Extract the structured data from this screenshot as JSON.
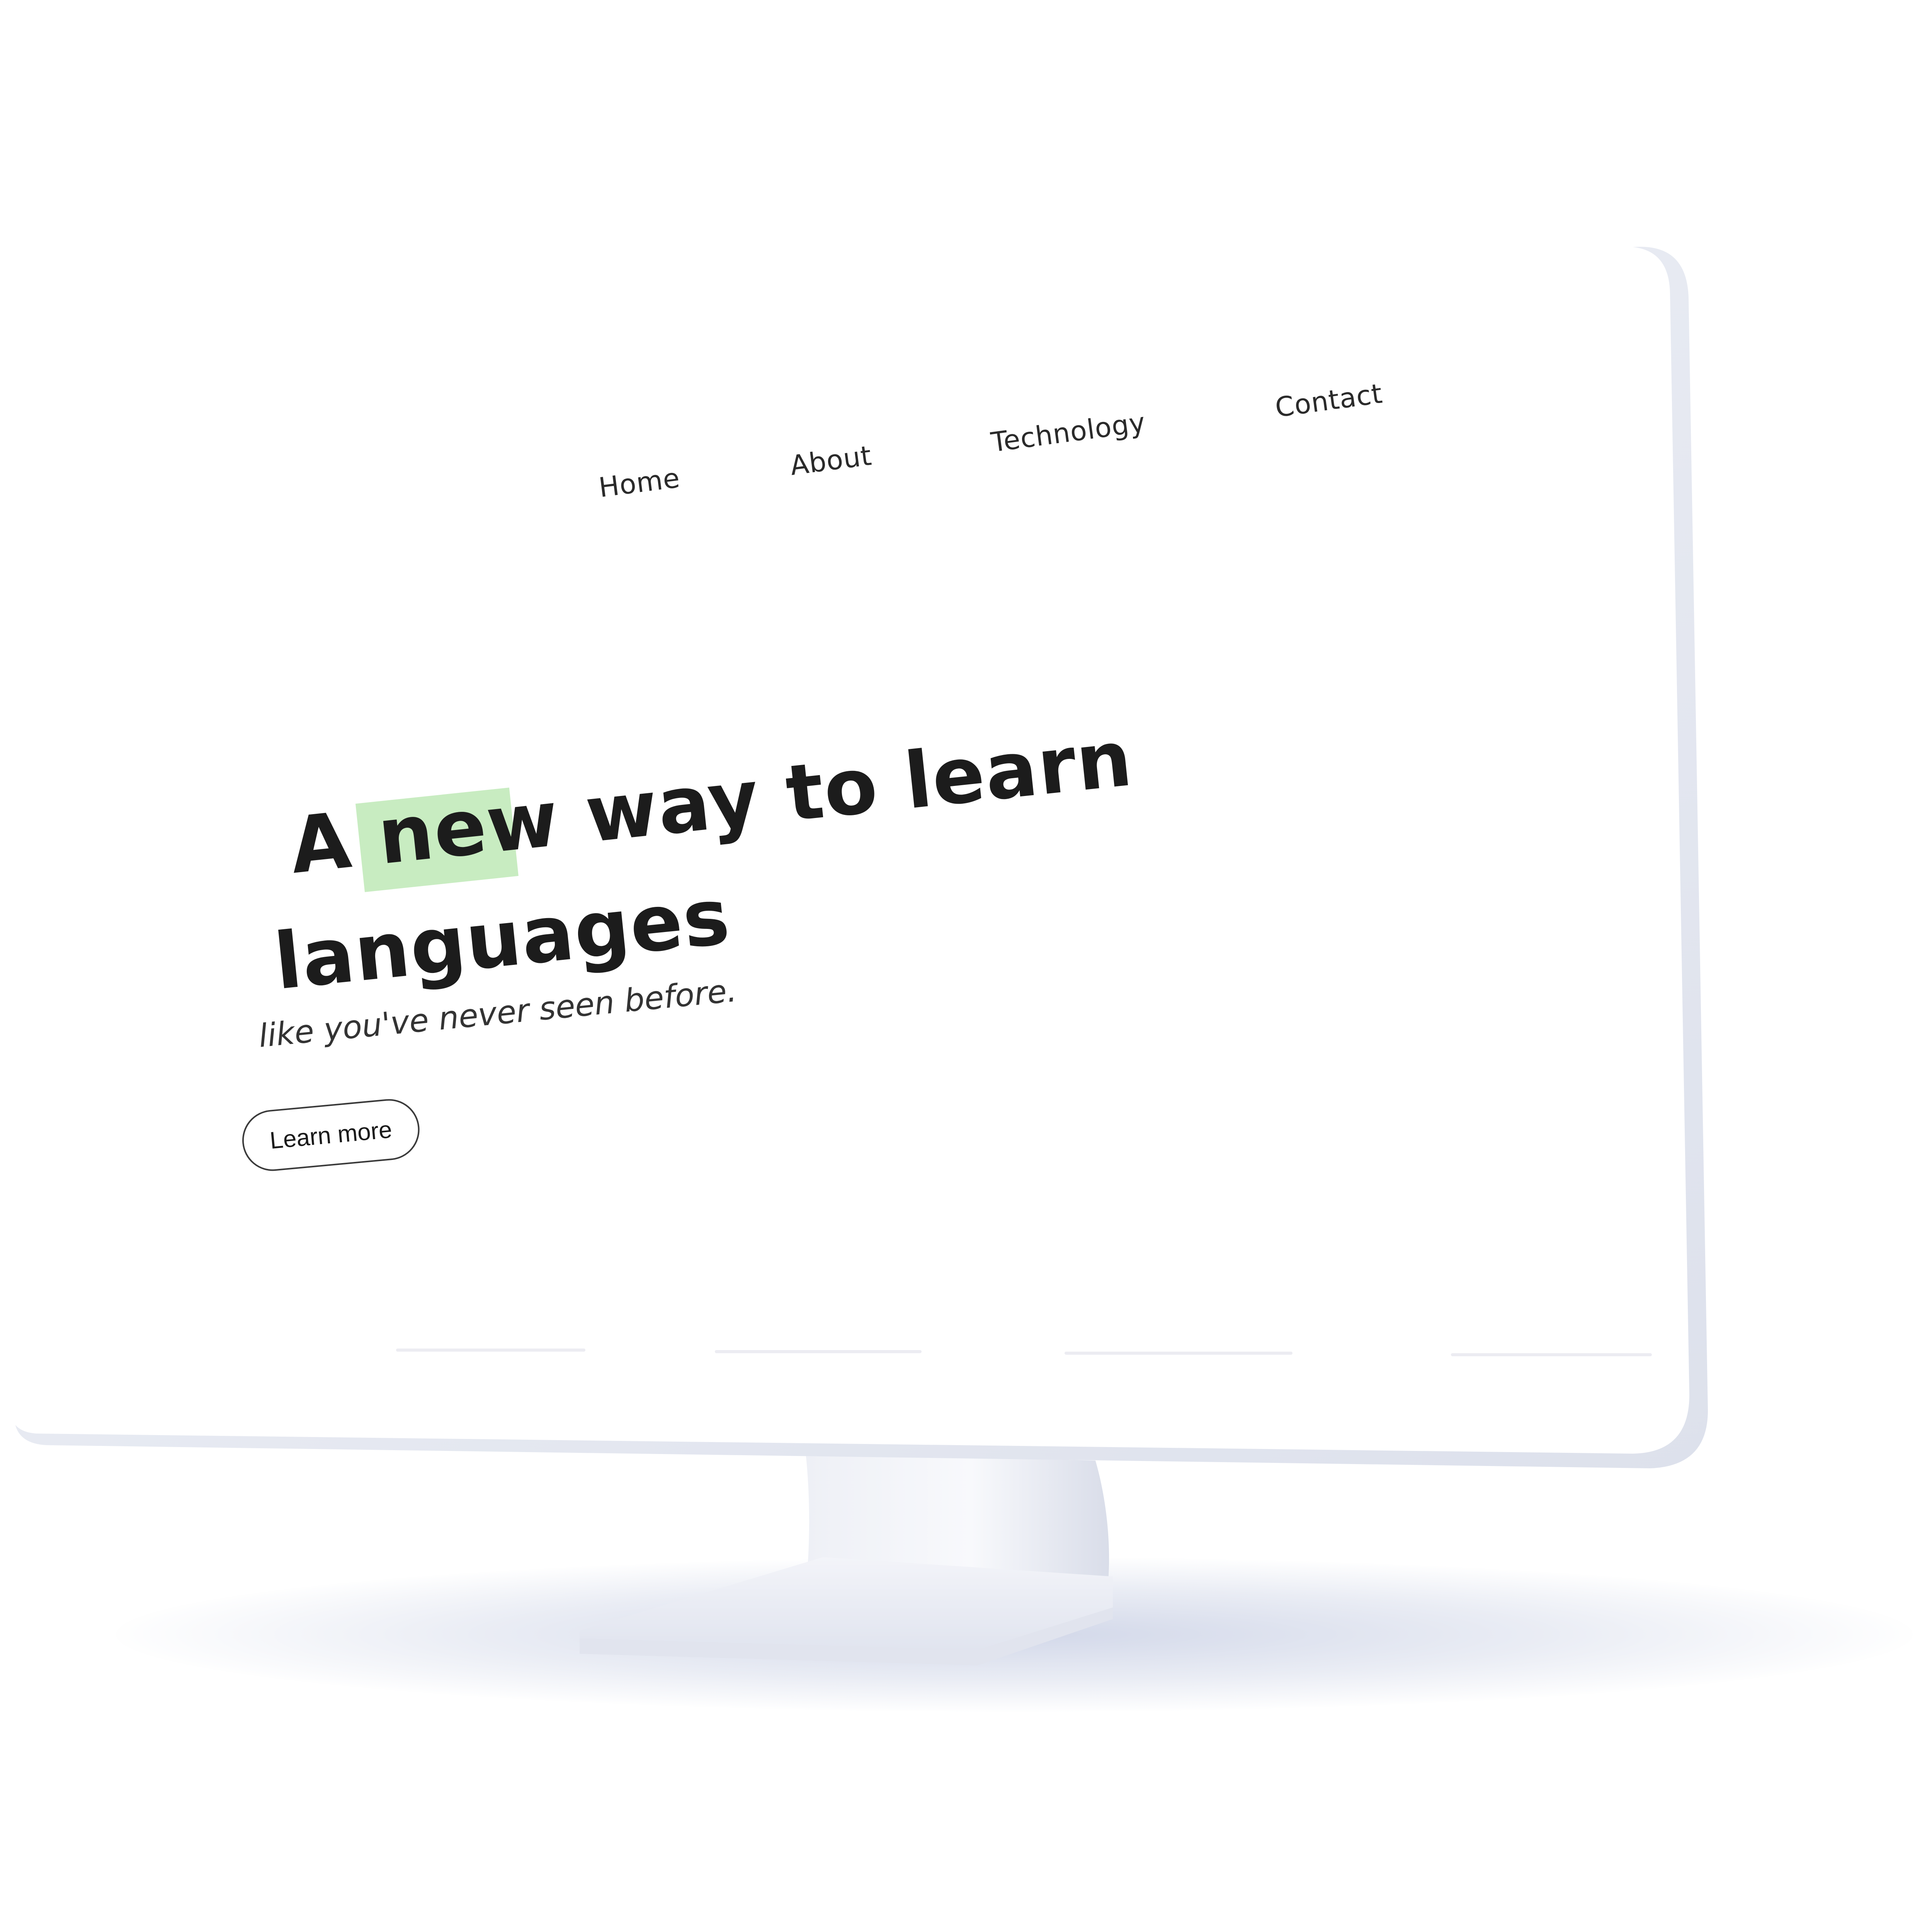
{
  "nav": {
    "items": [
      {
        "label": "Home"
      },
      {
        "label": "About"
      },
      {
        "label": "Technology"
      },
      {
        "label": "Contact"
      }
    ]
  },
  "hero": {
    "headline_prefix": "A",
    "headline_highlight": "new",
    "headline_rest": "way to learn",
    "headline_line2": "languages",
    "subline": "like you've never seen before.",
    "cta_label": "Learn more"
  },
  "colors": {
    "highlight": "#c8ecc1",
    "text": "#1c1c1c",
    "background": "#ffffff",
    "bezel": "#e3e6ef"
  }
}
